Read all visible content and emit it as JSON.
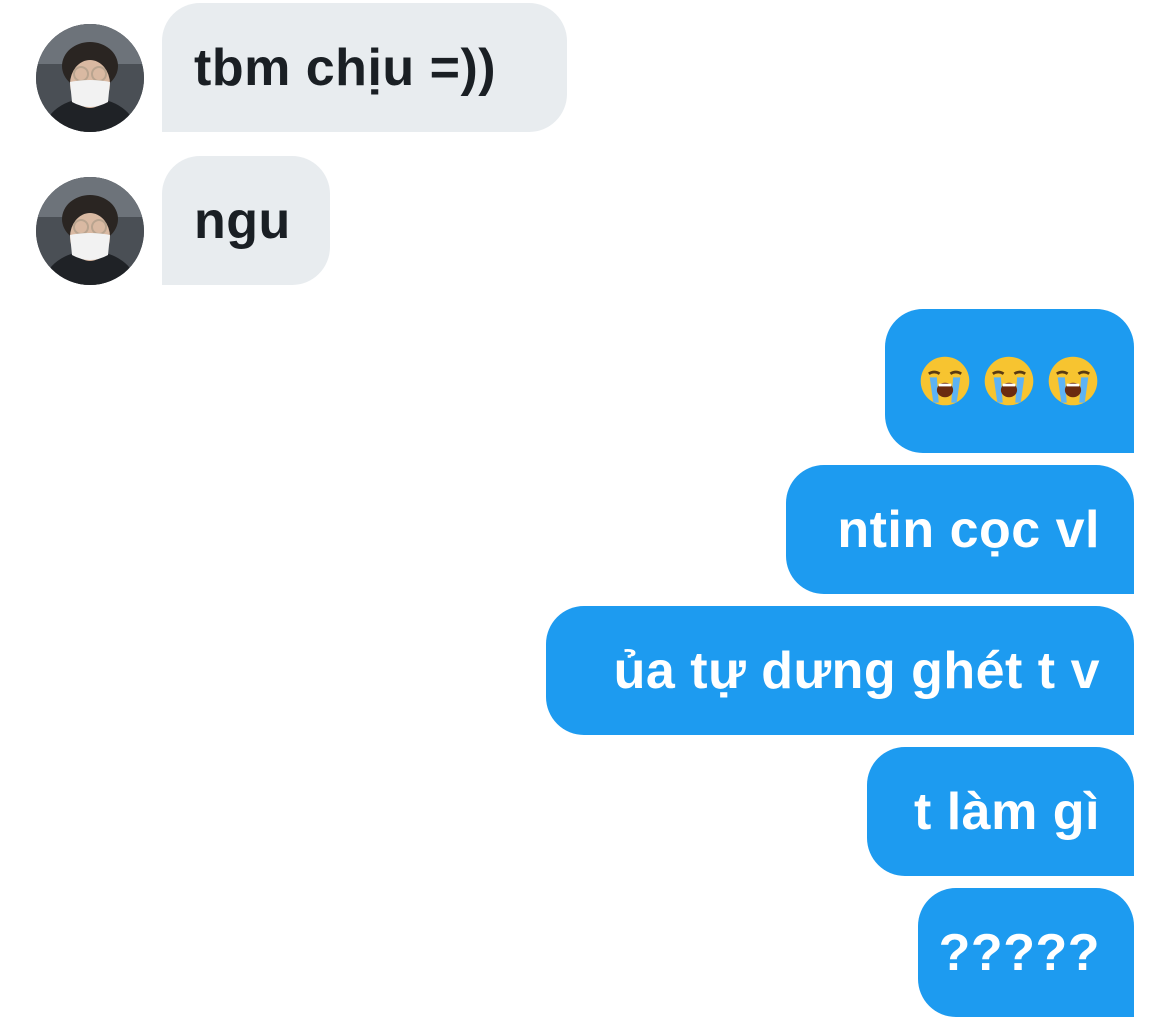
{
  "incoming": [
    {
      "text": "tbm chịu =))"
    },
    {
      "text": "ngu"
    }
  ],
  "outgoing": [
    {
      "emoji": [
        "loudly-crying-face",
        "loudly-crying-face",
        "loudly-crying-face"
      ]
    },
    {
      "text": "ntin cọc vl"
    },
    {
      "text": "ủa tự dưng ghét t v"
    },
    {
      "text": "t làm gì"
    },
    {
      "text": "?????"
    }
  ],
  "colors": {
    "incoming_bubble": "#e8ecef",
    "incoming_text": "#1a1f24",
    "outgoing_bubble": "#1d9bf0",
    "outgoing_text": "#ffffff"
  },
  "icons": {
    "avatar": "user-avatar-photo",
    "emoji": "loudly-crying-face"
  }
}
